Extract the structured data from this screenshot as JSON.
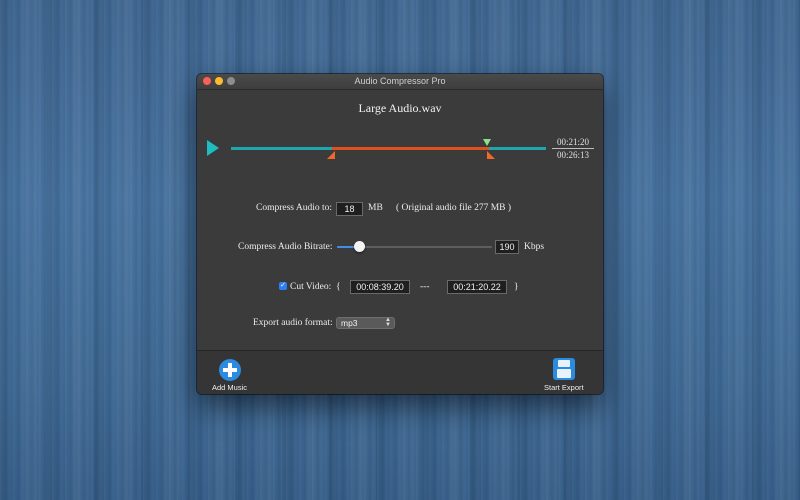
{
  "window": {
    "title": "Audio Compressor Pro"
  },
  "file": {
    "name": "Large Audio.wav"
  },
  "timeline": {
    "current_time": "00:21:20",
    "total_time": "00:26:13"
  },
  "compress": {
    "label": "Compress Audio to:",
    "value": "18",
    "unit": "MB",
    "original_note": "( Original audio file 277 MB )"
  },
  "bitrate": {
    "label": "Compress Audio Bitrate:",
    "value": "190",
    "unit": "Kbps"
  },
  "cut": {
    "label": "Cut Video:",
    "checked": true,
    "open_brace": "{",
    "start": "00:08:39.20",
    "separator": "---",
    "end": "00:21:20.22",
    "close_brace": "}"
  },
  "export": {
    "label": "Export audio format:",
    "format": "mp3"
  },
  "footer": {
    "add_label": "Add Music",
    "export_label": "Start Export"
  },
  "colors": {
    "accent": "#1ea7ad",
    "selection": "#e0501c",
    "button": "#2a8be0"
  }
}
